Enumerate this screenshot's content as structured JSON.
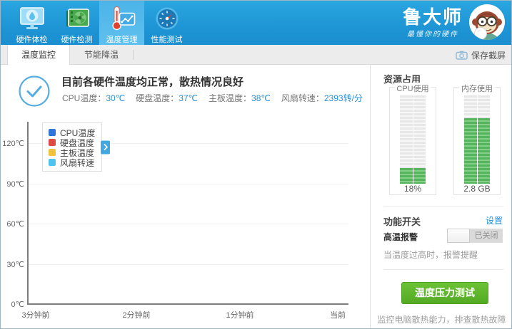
{
  "header": {
    "brand": {
      "name": "鲁大师",
      "slogan": "最懂你的硬件"
    },
    "toolbar": [
      {
        "label": "硬件体检",
        "icon": "monitor-drop-icon",
        "active": false
      },
      {
        "label": "硬件检测",
        "icon": "gpu-card-icon",
        "active": false
      },
      {
        "label": "温度管理",
        "icon": "thermometer-chart-icon",
        "active": true
      },
      {
        "label": "性能测试",
        "icon": "gauge-icon",
        "active": false
      }
    ]
  },
  "tabbar": {
    "tabs": [
      {
        "label": "温度监控",
        "active": true
      },
      {
        "label": "节能降温",
        "active": false
      }
    ],
    "save_screenshot": "保存截屏"
  },
  "status": {
    "title": "目前各硬件温度均正常，散热情况良好",
    "metrics": [
      {
        "label": "CPU温度：",
        "value": "30℃"
      },
      {
        "label": "硬盘温度：",
        "value": "37℃"
      },
      {
        "label": "主板温度：",
        "value": "38℃"
      },
      {
        "label": "风扇转速：",
        "value": "2393转/分"
      }
    ]
  },
  "chart_data": {
    "type": "line",
    "title": "",
    "legend_position": "top-left",
    "grid": true,
    "y_ticks": [
      "120℃",
      "90℃",
      "60℃",
      "30℃",
      "0℃"
    ],
    "ylim": [
      0,
      120
    ],
    "x_ticks": [
      "3分钟前",
      "2分钟前",
      "1分钟前",
      "当前"
    ],
    "series": [
      {
        "name": "CPU温度",
        "color": "#2e74d9",
        "values": []
      },
      {
        "name": "硬盘温度",
        "color": "#dd4b42",
        "values": []
      },
      {
        "name": "主板温度",
        "color": "#f0c23d",
        "values": []
      },
      {
        "name": "风扇转速",
        "color": "#4fc3ef",
        "values": []
      }
    ]
  },
  "sidebar": {
    "resource_title": "资源占用",
    "gauges": [
      {
        "label": "CPU使用",
        "value": "18%",
        "percent": 18
      },
      {
        "label": "内存使用",
        "value": "2.8 GB",
        "percent": 74
      }
    ],
    "switch_title": "功能开关",
    "settings_link": "设置",
    "alarm": {
      "label": "高温报警",
      "state": "已关闭",
      "desc": "当温度过高时，报警提醒"
    },
    "stress_button": "温度压力测试",
    "footer": "监控电脑散热能力，排查散热故障"
  },
  "colors": {
    "header_blue": "#1e95d5",
    "accent_blue": "#2490d9",
    "gauge_green": "#55b55c",
    "button_green": "#53ab24"
  }
}
